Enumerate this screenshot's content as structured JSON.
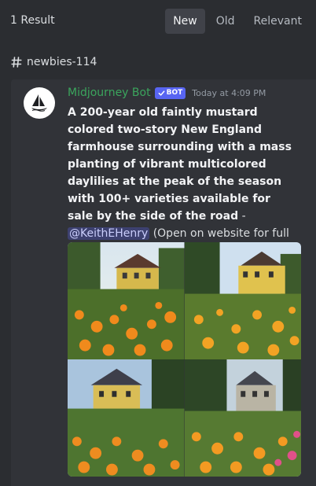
{
  "results": {
    "count_label": "1 Result"
  },
  "sort": {
    "tabs": [
      "New",
      "Old",
      "Relevant"
    ],
    "active": "New"
  },
  "channel": {
    "name": "newbies-114"
  },
  "message": {
    "author": "Midjourney Bot",
    "bot_tag": "BOT",
    "timestamp": "Today at 4:09 PM",
    "prompt": "A 200-year old faintly mustard colored two-story New England farmhouse surrounding with a mass planting of vibrant multicolored daylilies at the peak of the season with 100+ varieties available for sale by the side of the road",
    "separator": " - ",
    "mention": "@KeithEHenry",
    "suffix": " (Open on website for full quality) (fast)"
  },
  "colors": {
    "background": "#2b2d31",
    "card": "#313338",
    "author": "#3ba55d",
    "bot_tag": "#5865f2",
    "mention_bg": "#3c4270"
  },
  "icons": [
    "hash-icon",
    "checkmark-icon",
    "sailboat-logo-icon"
  ]
}
